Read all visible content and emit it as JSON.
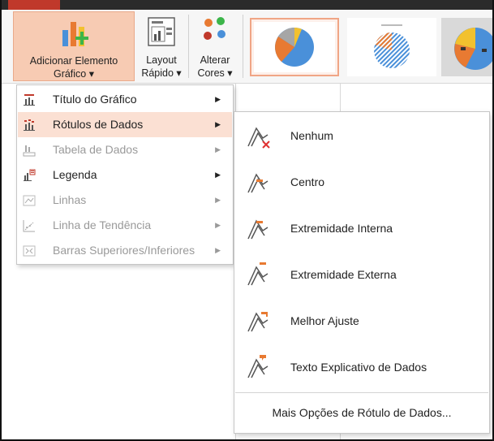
{
  "ribbon": {
    "add_element": {
      "line1": "Adicionar Elemento",
      "line2": "Gráfico ▾"
    },
    "quick_layout": {
      "line1": "Layout",
      "line2": "Rápido ▾"
    },
    "change_colors": {
      "line1": "Alterar",
      "line2": "Cores ▾"
    }
  },
  "main_menu": {
    "items": [
      {
        "label": "Título do Gráfico",
        "state": "enabled"
      },
      {
        "label": "Rótulos de Dados",
        "state": "highlighted"
      },
      {
        "label": "Tabela de Dados",
        "state": "disabled"
      },
      {
        "label": "Legenda",
        "state": "enabled"
      },
      {
        "label": "Linhas",
        "state": "disabled"
      },
      {
        "label": "Linha de Tendência",
        "state": "disabled"
      },
      {
        "label": "Barras Superiores/Inferiores",
        "state": "disabled"
      }
    ],
    "arrow": "▶"
  },
  "sub_menu": {
    "items": [
      {
        "label": "Nenhum"
      },
      {
        "label": "Centro"
      },
      {
        "label": "Extremidade Interna"
      },
      {
        "label": "Extremidade Externa"
      },
      {
        "label": "Melhor Ajuste"
      },
      {
        "label": "Texto Explicativo de Dados"
      }
    ],
    "more": "Mais Opções de Rótulo de Dados..."
  },
  "colors": {
    "accent": "#f7cbb3",
    "highlight": "#fbe0d3",
    "pie_blue": "#4a90d9",
    "pie_orange": "#e87a32",
    "pie_gray": "#a6a6a6",
    "pie_yellow": "#f2c12e"
  }
}
